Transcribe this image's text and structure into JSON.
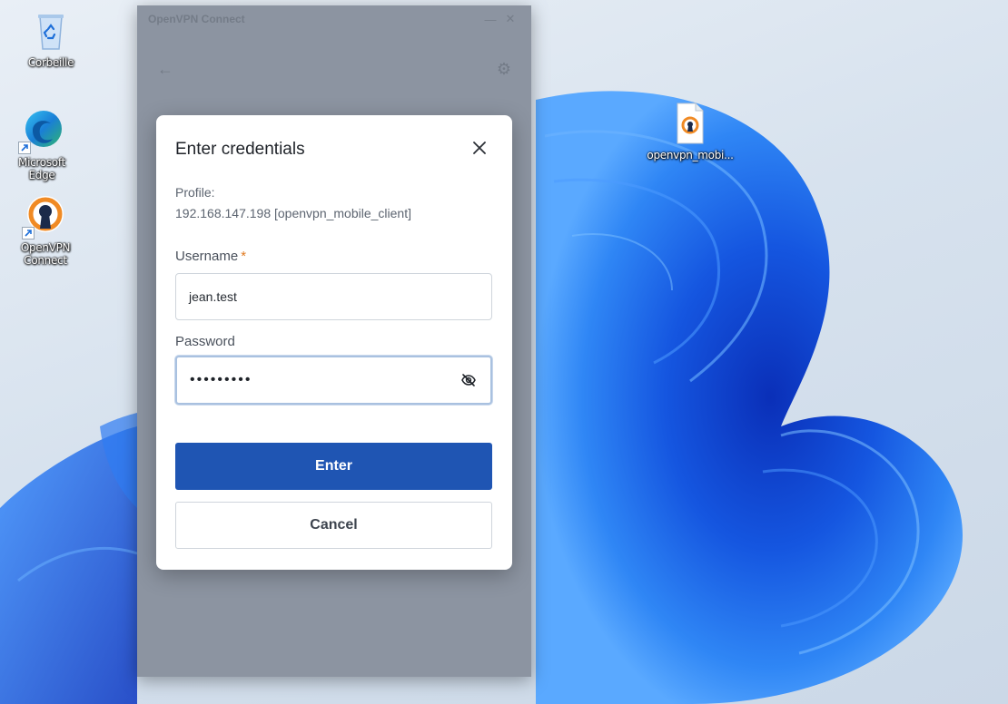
{
  "desktop": {
    "icons": [
      {
        "label": "Corbeille",
        "icon": "recycle-bin-icon"
      },
      {
        "label": "Microsoft Edge",
        "icon": "edge-icon"
      },
      {
        "label": "OpenVPN\nConnect",
        "icon": "openvpn-icon"
      },
      {
        "label": "openvpn_mobi...",
        "icon": "openvpn-file-icon"
      }
    ]
  },
  "app_window": {
    "title": "OpenVPN Connect"
  },
  "dialog": {
    "title": "Enter credentials",
    "profile_label": "Profile:",
    "profile_value": "192.168.147.198 [openvpn_mobile_client]",
    "username_label": "Username",
    "required_mark": "*",
    "username_value": "jean.test",
    "password_label": "Password",
    "password_value": "•••••••••",
    "enter_label": "Enter",
    "cancel_label": "Cancel"
  },
  "colors": {
    "primary": "#1f55b3",
    "required": "#e07a1f"
  }
}
